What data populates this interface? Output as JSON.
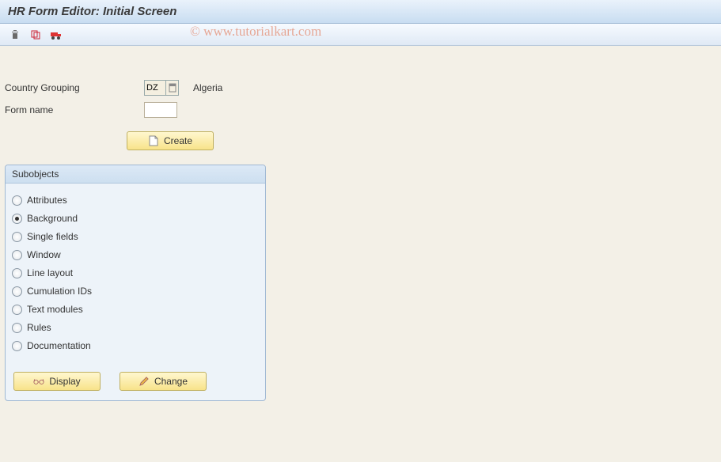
{
  "title": "HR Form Editor: Initial Screen",
  "watermark": "© www.tutorialkart.com",
  "labels": {
    "country_grouping": "Country Grouping",
    "form_name": "Form name"
  },
  "country_grouping": {
    "value": "DZ",
    "text": "Algeria"
  },
  "form_name_value": "",
  "buttons": {
    "create": "Create",
    "display": "Display",
    "change": "Change"
  },
  "panel": {
    "title": "Subobjects",
    "options": [
      {
        "label": "Attributes",
        "selected": false
      },
      {
        "label": "Background",
        "selected": true
      },
      {
        "label": "Single fields",
        "selected": false
      },
      {
        "label": "Window",
        "selected": false
      },
      {
        "label": "Line layout",
        "selected": false
      },
      {
        "label": "Cumulation IDs",
        "selected": false
      },
      {
        "label": "Text modules",
        "selected": false
      },
      {
        "label": "Rules",
        "selected": false
      },
      {
        "label": "Documentation",
        "selected": false
      }
    ]
  }
}
